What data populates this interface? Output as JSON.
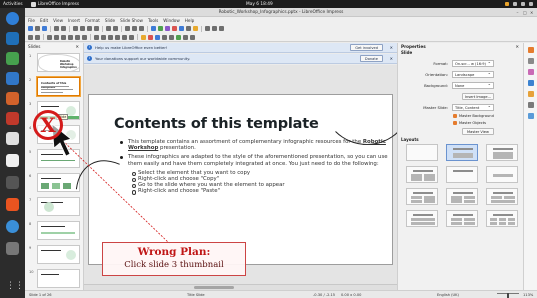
{
  "topbar": {
    "activities": "Activities",
    "app_name": "LibreOffice Impress",
    "clock": "May 6  18:49"
  },
  "window": {
    "title": "Robotic_Workshop_Infographics.pptx - LibreOffice Impress",
    "minimize": "–",
    "maximize": "□",
    "close": "✕"
  },
  "menu": [
    "File",
    "Edit",
    "View",
    "Insert",
    "Format",
    "Slide",
    "Slide Show",
    "Tools",
    "Window",
    "Help"
  ],
  "slides_pane": {
    "header": "Slides",
    "close": "✕",
    "tooltip": "Slide"
  },
  "thumbnails": [
    {
      "num": "1",
      "title": "Robotic Workshop Infographics"
    },
    {
      "num": "2",
      "title": "Contents of this template"
    },
    {
      "num": "3",
      "title": ""
    },
    {
      "num": "4",
      "title": ""
    },
    {
      "num": "5",
      "title": ""
    },
    {
      "num": "6",
      "title": ""
    },
    {
      "num": "7",
      "title": ""
    },
    {
      "num": "8",
      "title": ""
    },
    {
      "num": "9",
      "title": ""
    },
    {
      "num": "10",
      "title": ""
    },
    {
      "num": "11",
      "title": ""
    }
  ],
  "infobars": {
    "help_text": "Help us make LibreOffice even better!",
    "help_button": "Get involved",
    "donate_text": "Your donations support our worldwide community.",
    "donate_button": "Donate",
    "close": "✕"
  },
  "slide": {
    "title": "Contents of this template",
    "bullet1_pre": "This template contains an assortment of complementary infographic resources for the ",
    "bullet1_link": "Robotic Workshop",
    "bullet1_post": " presentation.",
    "bullet2": "These infographics are adapted to the style of the aforementioned presentation, so you can use them easily and have them completely integrated at once. You just need to do the following:",
    "subs": [
      "Select the element that you want to copy",
      "Right-click and choose \"Copy\"",
      "Go to the slide where you want the element to appear",
      "Right-click and choose \"Paste\""
    ]
  },
  "properties": {
    "header": "Properties",
    "section_slide": "Slide",
    "close": "✕",
    "format_label": "Format:",
    "format_value": "On-scr... w (16:9)",
    "orientation_label": "Orientation:",
    "orientation_value": "Landscape",
    "background_label": "Background:",
    "background_value": "None",
    "insert_image": "Insert Image...",
    "master_slide_label": "Master Slide:",
    "master_slide_value": "Title, Content",
    "master_background": "Master Background",
    "master_objects": "Master Objects",
    "master_view": "Master View",
    "layouts_header": "Layouts"
  },
  "statusbar": {
    "slide_info": "Slide 1 of 26",
    "master": "Title Slide",
    "position": "-0.30 / -2.15",
    "size": "0.00 x 0.00",
    "language": "English (UK)",
    "zoom": "113%"
  },
  "annotation": {
    "mark": "X",
    "title": "Wrong Plan:",
    "subtitle": "Click slide 3 thumbnail"
  },
  "colors": {
    "accent_orange": "#e57c2e",
    "annotation_red": "#d41b1b",
    "info_blue": "#2f6fca"
  }
}
